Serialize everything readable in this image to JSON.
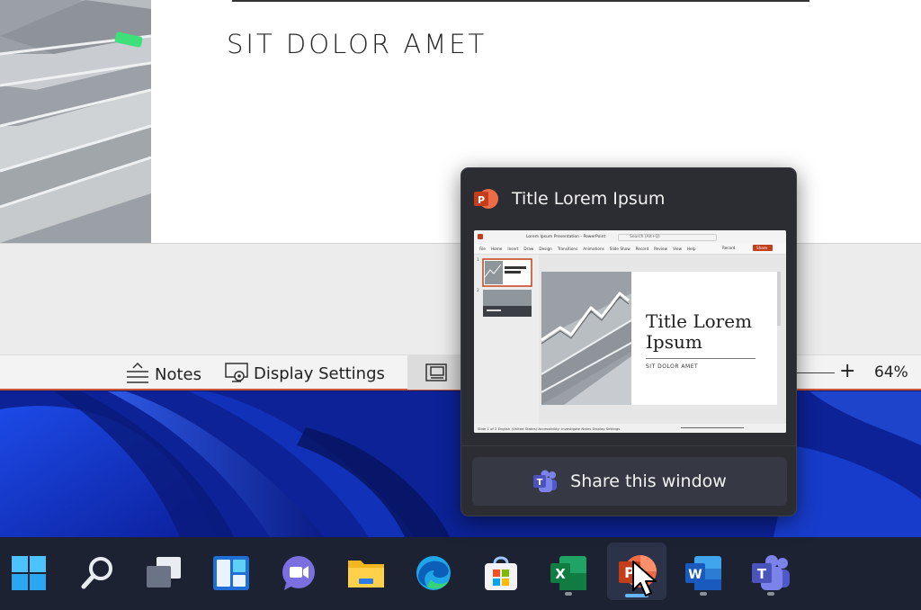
{
  "slide": {
    "subtitle": "SIT DOLOR AMET"
  },
  "status_bar": {
    "notes_label": "Notes",
    "display_settings_label": "Display Settings",
    "zoom_plus": "+",
    "zoom_level": "64%"
  },
  "flyout": {
    "window_title": "Title Lorem Ipsum",
    "share_label": "Share this window",
    "thumbnail": {
      "doc_name": "Lorem Ipsum Presentation - PowerPoint",
      "search_placeholder": "Search (Alt+Q)",
      "menu": [
        "File",
        "Home",
        "Insert",
        "Draw",
        "Design",
        "Transitions",
        "Animations",
        "Slide Show",
        "Record",
        "Review",
        "View",
        "Help"
      ],
      "record_label": "Record",
      "share_label": "Share",
      "slide_title": "Title Lorem Ipsum",
      "slide_subtitle": "SIT DOLOR AMET",
      "slide_numbers": [
        "1",
        "2"
      ],
      "status_text": "Slide 1 of 2    English (United States)    Accessibility: Investigate    Notes    Display Settings"
    }
  },
  "taskbar": {
    "apps": [
      {
        "name": "Start",
        "icon": "windows-start-icon"
      },
      {
        "name": "Search",
        "icon": "search-icon"
      },
      {
        "name": "Task View",
        "icon": "task-view-icon"
      },
      {
        "name": "Widgets",
        "icon": "widgets-icon"
      },
      {
        "name": "Chat",
        "icon": "chat-icon"
      },
      {
        "name": "File Explorer",
        "icon": "file-explorer-icon"
      },
      {
        "name": "Edge",
        "icon": "edge-icon"
      },
      {
        "name": "Microsoft Store",
        "icon": "store-icon"
      },
      {
        "name": "Excel",
        "icon": "excel-icon",
        "letter": "X"
      },
      {
        "name": "PowerPoint",
        "icon": "powerpoint-icon",
        "letter": "P"
      },
      {
        "name": "Word",
        "icon": "word-icon",
        "letter": "W"
      },
      {
        "name": "Teams",
        "icon": "teams-icon",
        "letter": "T"
      }
    ]
  },
  "colors": {
    "powerpoint": "#c43e1c",
    "excel": "#107c41",
    "word": "#185abd",
    "teams": "#5b5fc7",
    "active_indicator": "#64b7ff"
  }
}
